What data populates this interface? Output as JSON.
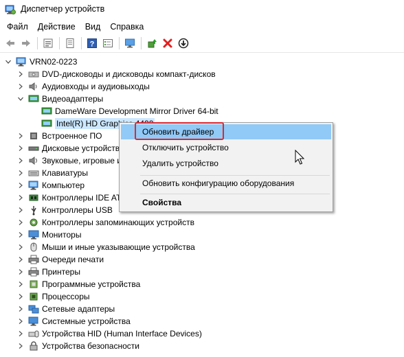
{
  "window": {
    "title": "Диспетчер устройств",
    "icon": "device-manager-icon"
  },
  "menu": [
    "Файл",
    "Действие",
    "Вид",
    "Справка"
  ],
  "toolbar": [
    "back-icon",
    "forward-icon",
    "properties-icon",
    "update-icon",
    "help-icon",
    "view-icon",
    "scan-icon",
    "enable-icon",
    "uninstall-icon",
    "download-icon"
  ],
  "tree": {
    "root": "VRN02-0223",
    "items": [
      {
        "label": "DVD-дисководы и дисководы компакт-дисков",
        "icon": "dvd-drive-icon",
        "expanded": false
      },
      {
        "label": "Аудиовходы и аудиовыходы",
        "icon": "speaker-icon",
        "expanded": false
      },
      {
        "label": "Видеоадаптеры",
        "icon": "display-adapter-icon",
        "expanded": true,
        "children": [
          {
            "label": "DameWare Development Mirror Driver 64-bit",
            "icon": "display-adapter-icon"
          },
          {
            "label": "Intel(R) HD Graphics 4400",
            "icon": "display-adapter-icon",
            "selected": true
          }
        ]
      },
      {
        "label": "Встроенное ПО",
        "icon": "firmware-icon",
        "expanded": false
      },
      {
        "label": "Дисковые устройства",
        "icon": "disk-drive-icon",
        "expanded": false
      },
      {
        "label": "Звуковые, игровые и видеоустройства",
        "icon": "sound-icon",
        "expanded": false
      },
      {
        "label": "Клавиатуры",
        "icon": "keyboard-icon",
        "expanded": false
      },
      {
        "label": "Компьютер",
        "icon": "computer-icon",
        "expanded": false
      },
      {
        "label": "Контроллеры IDE ATA/ATAPI",
        "icon": "ide-controller-icon",
        "expanded": false
      },
      {
        "label": "Контроллеры USB",
        "icon": "usb-icon",
        "expanded": false
      },
      {
        "label": "Контроллеры запоминающих устройств",
        "icon": "storage-controller-icon",
        "expanded": false
      },
      {
        "label": "Мониторы",
        "icon": "monitor-icon",
        "expanded": false
      },
      {
        "label": "Мыши и иные указывающие устройства",
        "icon": "mouse-icon",
        "expanded": false
      },
      {
        "label": "Очереди печати",
        "icon": "print-queue-icon",
        "expanded": false
      },
      {
        "label": "Принтеры",
        "icon": "printer-icon",
        "expanded": false
      },
      {
        "label": "Программные устройства",
        "icon": "software-device-icon",
        "expanded": false
      },
      {
        "label": "Процессоры",
        "icon": "processor-icon",
        "expanded": false
      },
      {
        "label": "Сетевые адаптеры",
        "icon": "network-adapter-icon",
        "expanded": false
      },
      {
        "label": "Системные устройства",
        "icon": "system-device-icon",
        "expanded": false
      },
      {
        "label": "Устройства HID (Human Interface Devices)",
        "icon": "hid-icon",
        "expanded": false
      },
      {
        "label": "Устройства безопасности",
        "icon": "security-device-icon",
        "expanded": false
      }
    ]
  },
  "context_menu": {
    "items": [
      {
        "label": "Обновить драйвер",
        "highlighted": true
      },
      {
        "label": "Отключить устройство"
      },
      {
        "label": "Удалить устройство"
      },
      {
        "label": "Обновить конфигурацию оборудования"
      },
      {
        "label": "Свойства",
        "bold": true
      }
    ]
  },
  "colors": {
    "highlight": "#91c9f7",
    "selection": "#cce8ff",
    "annotation": "#e0262b"
  }
}
